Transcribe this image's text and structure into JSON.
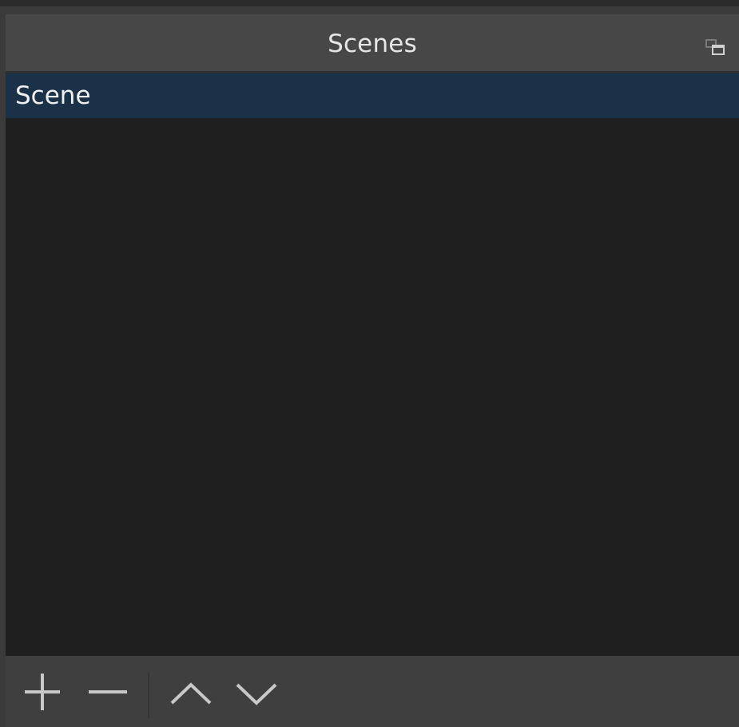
{
  "dock": {
    "title": "Scenes",
    "float_icon": "float-window-icon"
  },
  "scenes": [
    {
      "name": "Scene",
      "selected": true
    }
  ],
  "toolbar": {
    "buttons": [
      {
        "icon": "plus-icon"
      },
      {
        "icon": "minus-icon"
      },
      {
        "icon": "chevron-up-icon"
      },
      {
        "icon": "chevron-down-icon"
      }
    ]
  },
  "colors": {
    "header_bg": "#474747",
    "list_bg": "#1f1f1f",
    "selected_bg": "#1a3148",
    "toolbar_bg": "#3f3f3f",
    "icon": "#c8c8c8"
  }
}
